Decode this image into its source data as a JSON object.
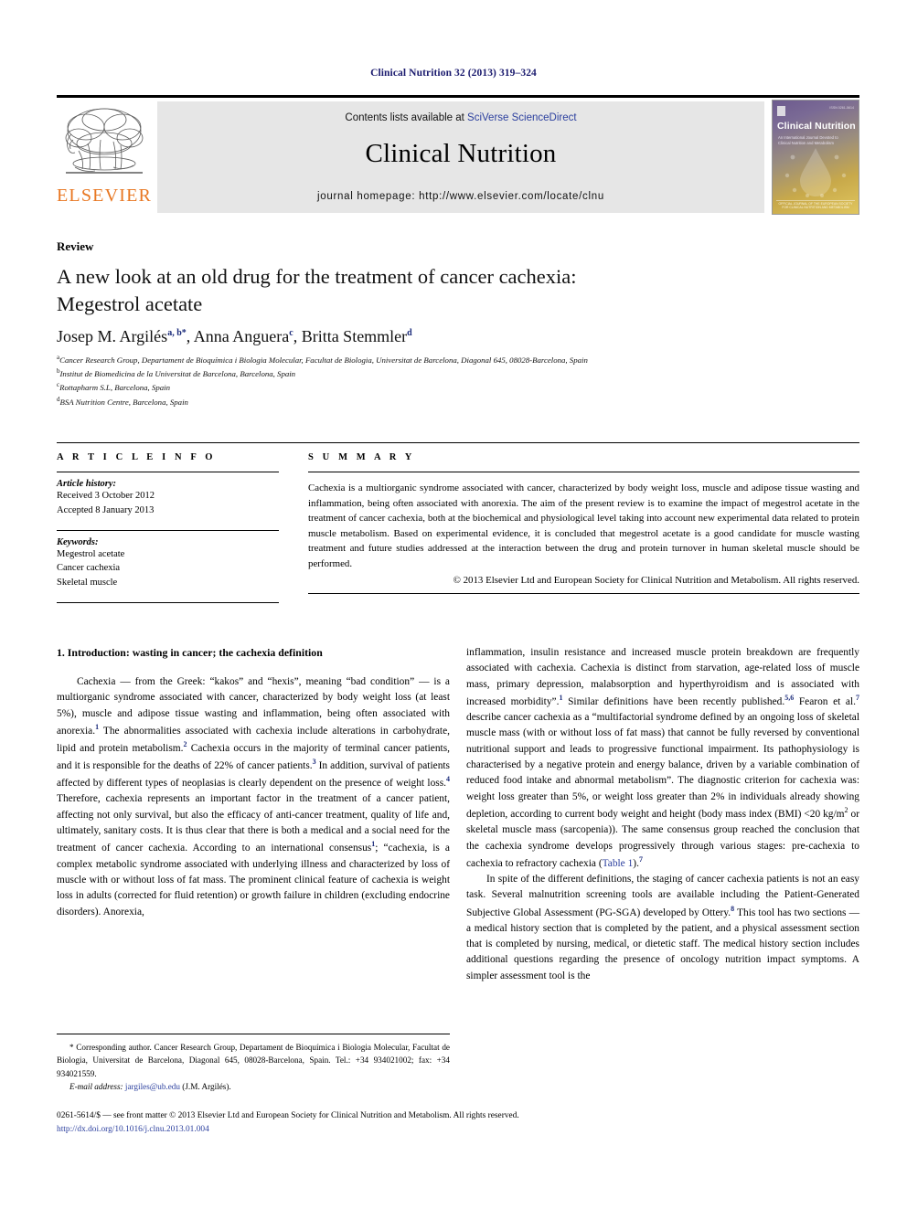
{
  "running_head": "Clinical Nutrition 32 (2013) 319–324",
  "masthead": {
    "publisher_name": "ELSEVIER",
    "contents_prefix": "Contents lists available at ",
    "contents_link": "SciVerse ScienceDirect",
    "journal_title": "Clinical Nutrition",
    "homepage_label": "journal homepage: http://www.elsevier.com/locate/clnu",
    "cover": {
      "title": "Clinical Nutrition",
      "subtitle": "An International Journal Devoted to Clinical Nutrition and Metabolism",
      "issn": "ISSN 0261-5614",
      "footer": "OFFICIAL JOURNAL OF THE EUROPEAN SOCIETY FOR CLINICAL NUTRITION AND METABOLISM"
    }
  },
  "article": {
    "doctype": "Review",
    "title_line1": "A new look at an old drug for the treatment of cancer cachexia:",
    "title_line2": "Megestrol acetate",
    "authors": [
      {
        "name": "Josep M. Argilés",
        "marks": "a, b",
        "corresponding": true
      },
      {
        "name": "Anna Anguera",
        "marks": "c",
        "corresponding": false
      },
      {
        "name": "Britta Stemmler",
        "marks": "d",
        "corresponding": false
      }
    ],
    "affiliations": [
      {
        "mark": "a",
        "text": "Cancer Research Group, Departament de Bioquímica i Biologia Molecular, Facultat de Biologia, Universitat de Barcelona, Diagonal 645, 08028-Barcelona, Spain"
      },
      {
        "mark": "b",
        "text": "Institut de Biomedicina de la Universitat de Barcelona, Barcelona, Spain"
      },
      {
        "mark": "c",
        "text": "Rottapharm S.L, Barcelona, Spain"
      },
      {
        "mark": "d",
        "text": "BSA Nutrition Centre, Barcelona, Spain"
      }
    ]
  },
  "info": {
    "section_label": "A R T I C L E   I N F O",
    "history_label": "Article history:",
    "received": "Received 3 October 2012",
    "accepted": "Accepted 8 January 2013",
    "keywords_label": "Keywords:",
    "keywords": [
      "Megestrol acetate",
      "Cancer cachexia",
      "Skeletal muscle"
    ]
  },
  "summary": {
    "section_label": "S U M M A R Y",
    "text": "Cachexia is a multiorganic syndrome associated with cancer, characterized by body weight loss, muscle and adipose tissue wasting and inflammation, being often associated with anorexia. The aim of the present review is to examine the impact of megestrol acetate in the treatment of cancer cachexia, both at the biochemical and physiological level taking into account new experimental data related to protein muscle metabolism. Based on experimental evidence, it is concluded that megestrol acetate is a good candidate for muscle wasting treatment and future studies addressed at the interaction between the drug and protein turnover in human skeletal muscle should be performed.",
    "copyright": "© 2013 Elsevier Ltd and European Society for Clinical Nutrition and Metabolism. All rights reserved."
  },
  "body": {
    "heading": "1. Introduction: wasting in cancer; the cachexia definition",
    "left_para1_a": "Cachexia — from the Greek: “kakos” and “hexis”, meaning “bad condition” — is a multiorganic syndrome associated with cancer, characterized by body weight loss (at least 5%), muscle and adipose tissue wasting and inflammation, being often associated with anorexia.",
    "left_para1_b": " The abnormalities associated with cachexia include alterations in carbohydrate, lipid and protein metabolism.",
    "left_para1_c": " Cachexia occurs in the majority of terminal cancer patients, and it is responsible for the deaths of 22% of cancer patients.",
    "left_para1_d": " In addition, survival of patients affected by different types of neoplasias is clearly dependent on the presence of weight loss.",
    "left_para1_e": " Therefore, cachexia represents an important factor in the treatment of a cancer patient, affecting not only survival, but also the efficacy of anti-cancer treatment, quality of life and, ultimately, sanitary costs. It is thus clear that there is both a medical and a social need for the treatment of cancer cachexia. According to an international consensus",
    "left_para1_f": "; “cachexia, is a complex metabolic syndrome associated with underlying illness and characterized by loss of muscle with or without loss of fat mass. The prominent clinical feature of cachexia is weight loss in adults (corrected for fluid retention) or growth failure in children (excluding endocrine disorders). Anorexia,",
    "right_para1_a": "inflammation, insulin resistance and increased muscle protein breakdown are frequently associated with cachexia. Cachexia is distinct from starvation, age-related loss of muscle mass, primary depression, malabsorption and hyperthyroidism and is associated with increased morbidity”.",
    "right_para1_b": " Similar definitions have been recently published.",
    "right_para1_c": " Fearon et al.",
    "right_para1_d": " describe cancer cachexia as a “multifactorial syndrome defined by an ongoing loss of skeletal muscle mass (with or without loss of fat mass) that cannot be fully reversed by conventional nutritional support and leads to progressive functional impairment. Its pathophysiology is characterised by a negative protein and energy balance, driven by a variable combination of reduced food intake and abnormal metabolism”. The diagnostic criterion for cachexia was: weight loss greater than 5%, or weight loss greater than 2% in individuals already showing depletion, according to current body weight and height (body mass index (BMI) <20 kg/m",
    "right_para1_e": " or skeletal muscle mass (sarcopenia)). The same consensus group reached the conclusion that the cachexia syndrome develops progressively through various stages: pre-cachexia to cachexia to refractory cachexia (",
    "right_table_link": "Table 1",
    "right_para1_f": ").",
    "right_para2_a": "In spite of the different definitions, the staging of cancer cachexia patients is not an easy task. Several malnutrition screening tools are available including the Patient-Generated Subjective Global Assessment (PG-SGA) developed by Ottery.",
    "right_para2_b": " This tool has two sections — a medical history section that is completed by the patient, and a physical assessment section that is completed by nursing, medical, or dietetic staff. The medical history section includes additional questions regarding the presence of oncology nutrition impact symptoms. A simpler assessment tool is the",
    "refs": {
      "r1": "1",
      "r2": "2",
      "r3": "3",
      "r4": "4",
      "r5": "5,6",
      "r7": "7",
      "r8": "8",
      "sup2": "2"
    }
  },
  "footnote": {
    "star": "*",
    "text": " Corresponding author. Cancer Research Group, Departament de Bioquímica i Biologia Molecular, Facultat de Biologia, Universitat de Barcelona, Diagonal 645, 08028-Barcelona, Spain. Tel.: +34 934021002; fax: +34 934021559.",
    "email_label": "E-mail address:",
    "email": "jargiles@ub.edu",
    "email_owner": " (J.M. Argilés)."
  },
  "page_footer": {
    "line1": "0261-5614/$ — see front matter © 2013 Elsevier Ltd and European Society for Clinical Nutrition and Metabolism. All rights reserved.",
    "doi": "http://dx.doi.org/10.1016/j.clnu.2013.01.004"
  },
  "colors": {
    "link": "#2b3f9e",
    "running_head": "#1a1a6e",
    "elsevier_orange": "#E87722",
    "band_gray": "#e6e6e6"
  }
}
